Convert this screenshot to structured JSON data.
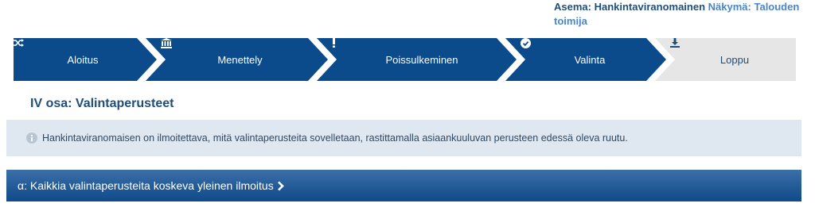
{
  "role": {
    "station_label": "Asema:",
    "station_value": "Hankintaviranomainen",
    "view_label": "Näkymä:",
    "view_value": "Talouden toimija"
  },
  "steps": [
    {
      "label": "Aloitus",
      "icon": "shuffle-icon",
      "state": "done"
    },
    {
      "label": "Menettely",
      "icon": "institution-icon",
      "state": "done"
    },
    {
      "label": "Poissulkeminen",
      "icon": "exclamation-icon",
      "state": "done"
    },
    {
      "label": "Valinta",
      "icon": "check-circle-icon",
      "state": "current"
    },
    {
      "label": "Loppu",
      "icon": "download-icon",
      "state": "inactive"
    }
  ],
  "colors": {
    "step_active": "#0b4a8b",
    "step_inactive": "#e6e6e6",
    "title": "#1f4e79",
    "info_bg": "#dfe8f0"
  },
  "section": {
    "title": "IV osa: Valintaperusteet"
  },
  "info": {
    "icon": "info-circle-icon",
    "text": "Hankintaviranomaisen on ilmoitettava, mitä valintaperusteita sovelletaan, rastittamalla asiaankuuluvan perusteen edessä oleva ruutu."
  },
  "accordion": {
    "label": "α: Kaikkia valintaperusteita koskeva yleinen ilmoitus",
    "icon": "chevron-right-icon"
  }
}
